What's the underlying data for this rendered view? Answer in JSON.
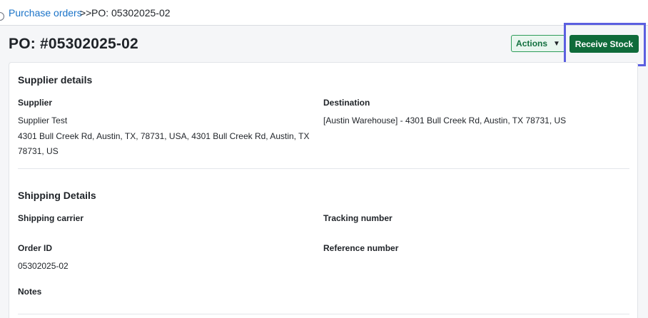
{
  "breadcrumb": {
    "parent_label": "Purchase orders",
    "separator": ">>",
    "current_label": "PO: 05302025-02"
  },
  "header": {
    "title": "PO: #05302025-02",
    "actions_label": "Actions",
    "actions_caret": "▼",
    "receive_label": "Receive Stock"
  },
  "supplier_details": {
    "title": "Supplier details",
    "supplier_label": "Supplier",
    "supplier_name": "Supplier Test",
    "supplier_address_line1": "4301 Bull Creek Rd, Austin, TX, 78731, USA, 4301 Bull Creek Rd, Austin, TX",
    "supplier_address_line2": "78731, US",
    "destination_label": "Destination",
    "destination_value": "[Austin Warehouse] - 4301 Bull Creek Rd, Austin, TX 78731, US"
  },
  "shipping_details": {
    "title": "Shipping Details",
    "carrier_label": "Shipping carrier",
    "tracking_label": "Tracking number",
    "order_id_label": "Order ID",
    "order_id_value": "05302025-02",
    "reference_label": "Reference number",
    "notes_label": "Notes"
  },
  "colors": {
    "link": "#1a73c8",
    "primary_button": "#0f6b3a",
    "secondary_button_bg": "#e8f6ee",
    "secondary_button_border": "#2e9c5a",
    "highlight": "#5b5fe0"
  }
}
